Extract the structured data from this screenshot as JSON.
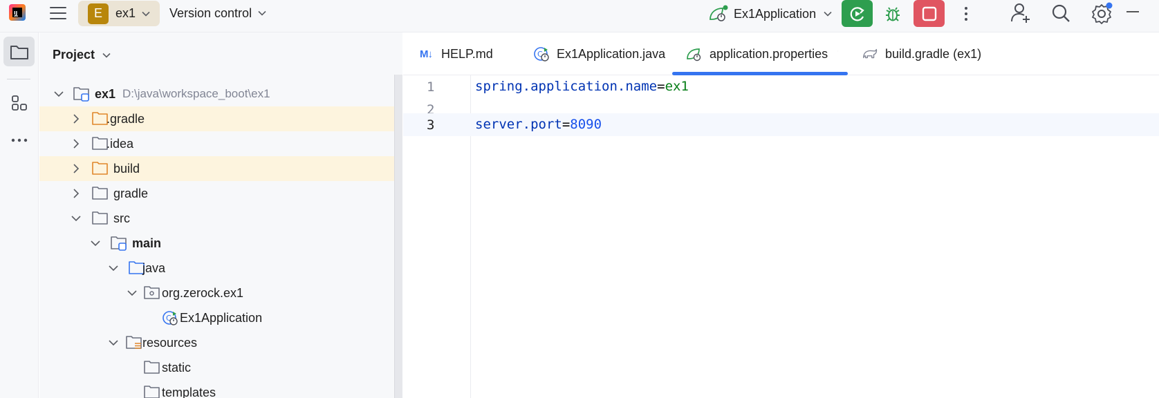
{
  "topbar": {
    "project_badge": "E",
    "project_name": "ex1",
    "vcs_label": "Version control",
    "run_config": "Ex1Application"
  },
  "project_panel": {
    "title": "Project",
    "tree": [
      {
        "label": "ex1",
        "path": "D:\\java\\workspace_boot\\ex1",
        "bold": true,
        "expanded": true,
        "icon": "module-folder-icon"
      },
      {
        "label": ".gradle",
        "expanded": false,
        "highlighted": true,
        "icon": "excluded-folder-icon"
      },
      {
        "label": ".idea",
        "expanded": false,
        "icon": "folder-icon"
      },
      {
        "label": "build",
        "expanded": false,
        "highlighted": true,
        "icon": "excluded-folder-icon"
      },
      {
        "label": "gradle",
        "expanded": false,
        "icon": "folder-icon"
      },
      {
        "label": "src",
        "expanded": true,
        "icon": "folder-icon"
      },
      {
        "label": "main",
        "bold": true,
        "expanded": true,
        "icon": "module-folder-icon"
      },
      {
        "label": "java",
        "expanded": true,
        "icon": "source-folder-icon"
      },
      {
        "label": "org.zerock.ex1",
        "expanded": true,
        "icon": "package-icon"
      },
      {
        "label": "Ex1Application",
        "icon": "spring-boot-class-icon"
      },
      {
        "label": "resources",
        "expanded": true,
        "icon": "resources-folder-icon"
      },
      {
        "label": "static",
        "icon": "folder-icon"
      },
      {
        "label": "templates",
        "icon": "folder-icon"
      }
    ]
  },
  "tabs": [
    {
      "label": "HELP.md",
      "icon_text": "M↓",
      "active": false
    },
    {
      "label": "Ex1Application.java",
      "active": false
    },
    {
      "label": "application.properties",
      "active": true
    },
    {
      "label": "build.gradle (ex1)",
      "active": false
    }
  ],
  "editor": {
    "lines": [
      {
        "number": "1",
        "key": "spring.application.name",
        "eq": "=",
        "value": "ex1",
        "value_type": "string"
      },
      {
        "number": "2",
        "key": "",
        "eq": "",
        "value": ""
      },
      {
        "number": "3",
        "key": "server.port",
        "eq": "=",
        "value": "8090",
        "value_type": "number"
      }
    ]
  },
  "colors": {
    "accent": "#3574f0",
    "run_green": "#2e9e4f",
    "stop_red": "#e05561",
    "project_badge": "#b8860b",
    "excluded_highlight": "#fdf4de"
  }
}
